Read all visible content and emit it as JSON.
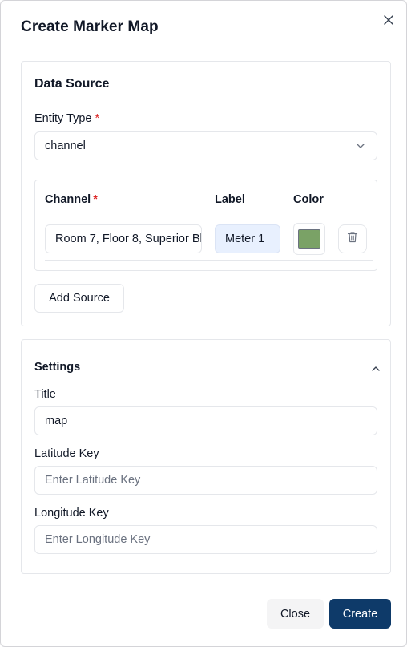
{
  "dialog": {
    "title": "Create Marker Map",
    "close_icon": "close-icon"
  },
  "data_source": {
    "title": "Data Source",
    "entity_type": {
      "label": "Entity Type",
      "required_mark": "*",
      "value": "channel",
      "icon": "chevron-down-icon"
    },
    "table": {
      "headers": {
        "channel": "Channel",
        "channel_required": "*",
        "label": "Label",
        "color": "Color"
      },
      "rows": [
        {
          "channel": "Room 7, Floor 8, Superior Bl",
          "label": "Meter 1",
          "color": "#7aa266",
          "delete_icon": "trash-icon"
        }
      ]
    },
    "add_source_label": "Add Source"
  },
  "settings": {
    "title": "Settings",
    "toggle_icon": "chevron-up-icon",
    "title_field": {
      "label": "Title",
      "value": "map"
    },
    "latitude_field": {
      "label": "Latitude Key",
      "value": "",
      "placeholder": "Enter Latitude Key"
    },
    "longitude_field": {
      "label": "Longitude Key",
      "value": "",
      "placeholder": "Enter Longitude Key"
    }
  },
  "footer": {
    "close_label": "Close",
    "create_label": "Create"
  },
  "colors": {
    "primary": "#0e3a69",
    "required": "#dc2626",
    "label_bg": "#e8f0fe"
  }
}
